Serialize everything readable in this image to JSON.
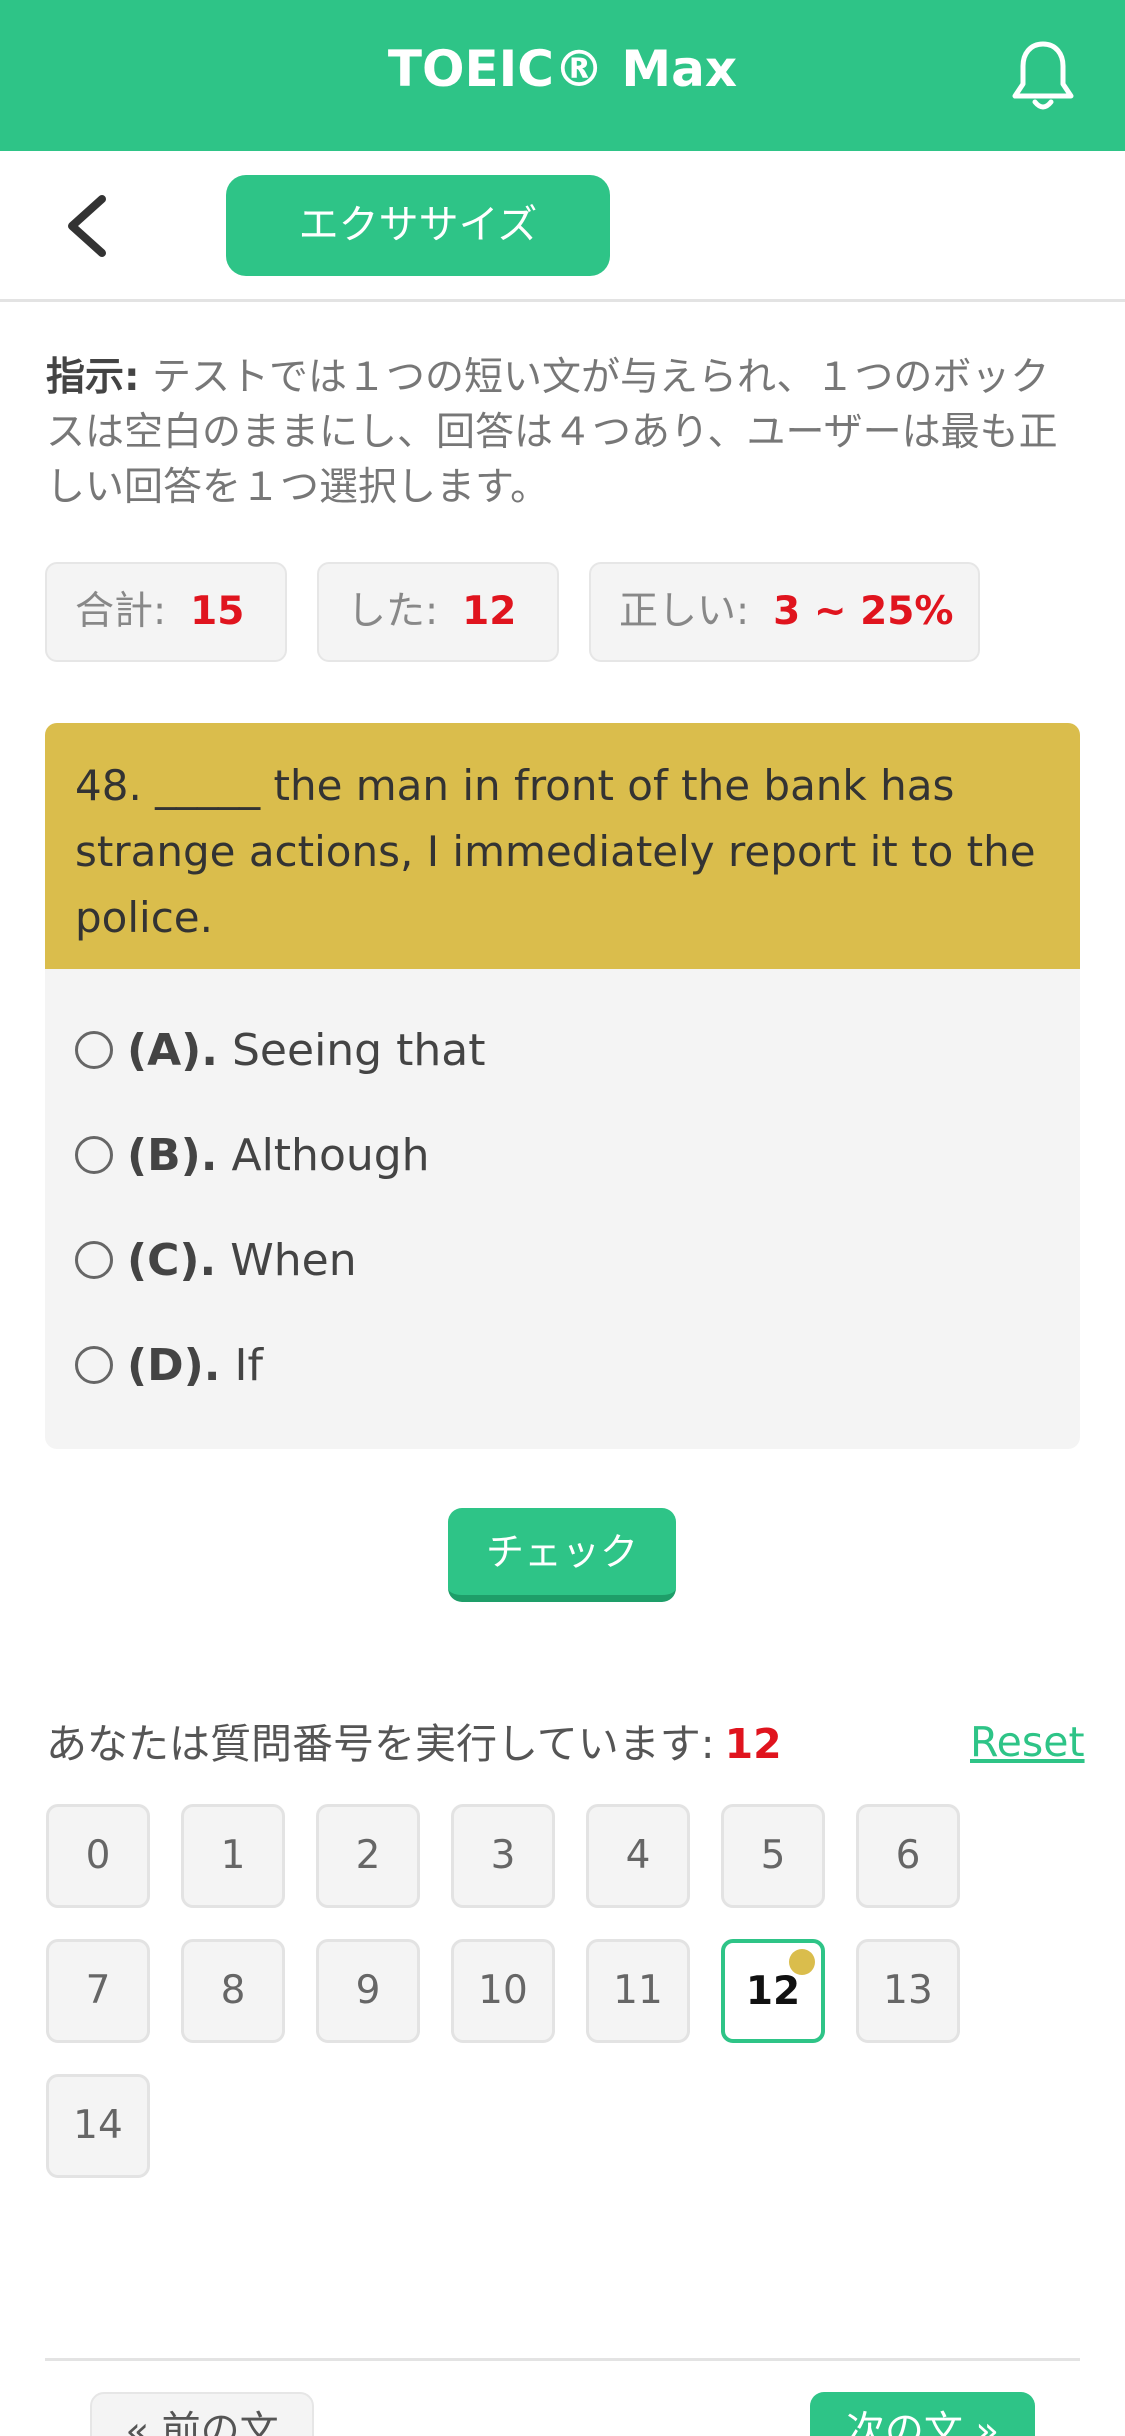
{
  "app": {
    "title": "TOEIC® Max",
    "bell_icon": "bell-icon",
    "accent": "#2ec487"
  },
  "nav": {
    "back_icon": "chevron-left-icon",
    "tab_label": "エクササイズ"
  },
  "instructions": {
    "label": "指示:",
    "text": " テストでは１つの短い文が与えられ、１つのボックスは空白のままにし、回答は４つあり、ユーザーは最も正しい回答を１つ選択します。"
  },
  "stats": {
    "total_label": "合計:",
    "total_value": "15",
    "done_label": "した:",
    "done_value": "12",
    "correct_label": "正しい:",
    "correct_value": "3 ~ 25%"
  },
  "question": {
    "text": "48. _____ the man in front of the bank has strange actions, I immediately report it to the police.",
    "options": [
      {
        "letter": "(A).",
        "text": "Seeing that"
      },
      {
        "letter": "(B).",
        "text": "Although"
      },
      {
        "letter": "(C).",
        "text": "When"
      },
      {
        "letter": "(D).",
        "text": "If"
      }
    ]
  },
  "check_label": "チェック",
  "progress": {
    "label": "あなたは質問番号を実行しています:",
    "current": "12",
    "reset_label": "Reset"
  },
  "question_numbers": [
    "0",
    "1",
    "2",
    "3",
    "4",
    "5",
    "6",
    "7",
    "8",
    "9",
    "10",
    "11",
    "12",
    "13",
    "14"
  ],
  "footer": {
    "prev_label": "« 前の文",
    "next_label": "次の文 »"
  }
}
